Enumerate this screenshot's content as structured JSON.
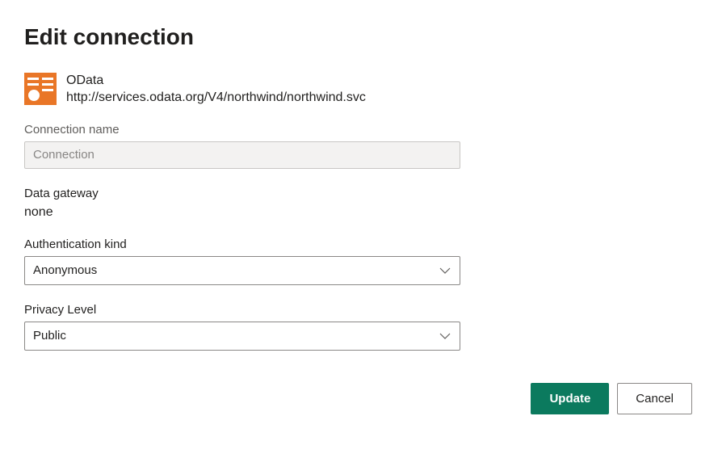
{
  "title": "Edit connection",
  "connection": {
    "type": "OData",
    "url": "http://services.odata.org/V4/northwind/northwind.svc"
  },
  "fields": {
    "connection_name": {
      "label": "Connection name",
      "placeholder": "Connection",
      "value": ""
    },
    "data_gateway": {
      "label": "Data gateway",
      "value": "none"
    },
    "authentication_kind": {
      "label": "Authentication kind",
      "selected": "Anonymous"
    },
    "privacy_level": {
      "label": "Privacy Level",
      "selected": "Public"
    }
  },
  "buttons": {
    "update": "Update",
    "cancel": "Cancel"
  }
}
